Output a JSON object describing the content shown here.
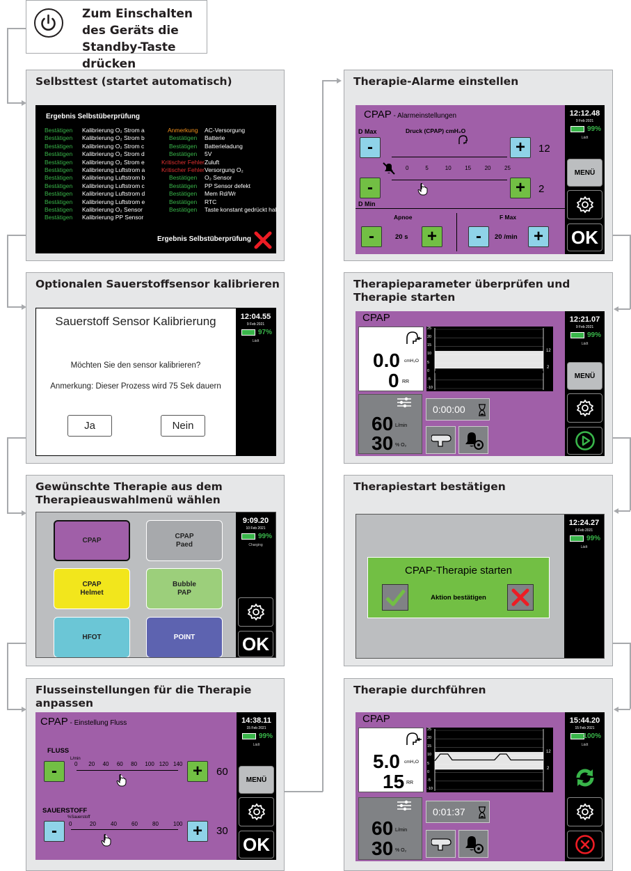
{
  "header": {
    "text1": "Zum Einschalten des Geräts die",
    "text2": "Standby-Taste drücken"
  },
  "panels": {
    "p1": {
      "title": "Selbsttest (startet automatisch)"
    },
    "p2": {
      "title": "Optionalen Sauerstoffsensor kalibrieren"
    },
    "p3": {
      "title1": "Gewünschte Therapie aus dem",
      "title2": "Therapieauswahlmenü wählen"
    },
    "p4": {
      "title1": "Flusseinstellungen für die Therapie",
      "title2": "anpassen"
    },
    "p5": {
      "title": "Therapie-Alarme einstellen"
    },
    "p6": {
      "title1": "Therapieparameter überprüfen und",
      "title2": "Therapie starten"
    },
    "p7": {
      "title": "Therapiestart bestätigen"
    },
    "p8": {
      "title": "Therapie durchführen"
    }
  },
  "selftest": {
    "heading": "Ergebnis Selbstüberprüfung",
    "left": [
      {
        "s": "Bestätigen",
        "t": "Kalibrierung O₂ Strom a"
      },
      {
        "s": "Bestätigen",
        "t": "Kalibrierung O₂ Strom b"
      },
      {
        "s": "Bestätigen",
        "t": "Kalibrierung O₂ Strom c"
      },
      {
        "s": "Bestätigen",
        "t": "Kalibrierung O₂ Strom d"
      },
      {
        "s": "Bestätigen",
        "t": "Kalibrierung O₂ Strom e"
      },
      {
        "s": "Bestätigen",
        "t": "Kalibrierung Luftstrom a"
      },
      {
        "s": "Bestätigen",
        "t": "Kalibrierung Luftstrom b"
      },
      {
        "s": "Bestätigen",
        "t": "Kalibrierung Luftstrom c"
      },
      {
        "s": "Bestätigen",
        "t": "Kalibrierung Luftstrom d"
      },
      {
        "s": "Bestätigen",
        "t": "Kalibrierung Luftstrom e"
      },
      {
        "s": "Bestätigen",
        "t": "Kalibrierung O₂ Sensor"
      },
      {
        "s": "Bestätigen",
        "t": "Kalibrierung PP Sensor"
      }
    ],
    "right": [
      {
        "s": "Anmerkung",
        "t": "AC-Versorgung",
        "c": "o"
      },
      {
        "s": "Bestätigen",
        "t": "Batterie",
        "c": "g"
      },
      {
        "s": "Bestätigen",
        "t": "Batterieladung",
        "c": "g"
      },
      {
        "s": "Bestätigen",
        "t": "5V",
        "c": "g"
      },
      {
        "s": "Kritischer Fehler",
        "t": "Zuluft",
        "c": "r"
      },
      {
        "s": "Kritischer Fehler",
        "t": "Versorgung O₂",
        "c": "r"
      },
      {
        "s": "Bestätigen",
        "t": "O₂ Sensor",
        "c": "g"
      },
      {
        "s": "Bestätigen",
        "t": "PP Sensor defekt",
        "c": "g"
      },
      {
        "s": "Bestätigen",
        "t": "Mem Rd/Wr",
        "c": "g"
      },
      {
        "s": "Bestätigen",
        "t": "RTC",
        "c": "g"
      },
      {
        "s": "Bestätigen",
        "t": "Taste konstant gedrückt halten",
        "c": "g"
      }
    ],
    "result": "Ergebnis Selbstüberprüfung"
  },
  "calib": {
    "title": "Sauerstoff Sensor Kalibrierung",
    "question": "Möchten Sie den sensor kalibrieren?",
    "note": "Anmerkung: Dieser Prozess wird 75 Sek dauern",
    "yes": "Ja",
    "no": "Nein",
    "time": "12:04.55",
    "date": "9 Feb 2021",
    "battery": "97%",
    "status": "Lädt"
  },
  "select": {
    "time": "9:09.20",
    "date": "10 Feb 2021",
    "battery": "99%",
    "status": "Charging",
    "ok": "OK",
    "b1": "CPAP",
    "b2a": "CPAP",
    "b2b": "Paed",
    "b3a": "CPAP",
    "b3b": "Helmet",
    "b4a": "Bubble",
    "b4b": "PAP",
    "b5": "HFOT",
    "b6": "POINT"
  },
  "flow": {
    "title": "CPAP",
    "subtitle": " - Einstellung Fluss",
    "time": "14:38.11",
    "date": "15 Feb 2021",
    "battery": "99%",
    "status": "Lädt",
    "menu": "MENÜ",
    "ok": "OK",
    "fluss": "FLUSS",
    "flussunit": "L/min",
    "flussticks": [
      "0",
      "20",
      "40",
      "60",
      "80",
      "100",
      "120",
      "140"
    ],
    "flussval": "60",
    "o2": "SAUERSTOFF",
    "o2unit": "%Sauerstoff",
    "o2ticks": [
      "0",
      "20",
      "40",
      "60",
      "80",
      "100"
    ],
    "o2val": "30"
  },
  "alarm": {
    "title": "CPAP",
    "subtitle": " - Alarmeinstellungen",
    "time": "12:12.48",
    "date": "9 Feb 2021",
    "battery": "99%",
    "status": "Lädt",
    "menu": "MENÜ",
    "ok": "OK",
    "dmax": "D Max",
    "dmin": "D Min",
    "druck": "Druck (CPAP) cmH₂O",
    "ticks": [
      "0",
      "5",
      "10",
      "15",
      "20",
      "25"
    ],
    "maxval": "12",
    "minval": "2",
    "apnoe": "Apnoe",
    "apnoeval": "20 s",
    "fmax": "F Max",
    "fmaxval": "20 /min"
  },
  "review": {
    "title": "CPAP",
    "time": "12:21.07",
    "date": "9 Feb 2021",
    "battery": "99%",
    "status": "Lädt",
    "menu": "MENÜ",
    "pressure": "0.0",
    "punit": "cmH₂O",
    "rr": "0",
    "rrunit": "RR",
    "timer": "0:00:00",
    "flow": "60",
    "flowunit": "L/min",
    "o2": "30",
    "o2unit": "% O₂",
    "yticks": [
      "25",
      "20",
      "15",
      "10",
      "5",
      "0",
      "-5",
      "-10"
    ],
    "hi": "12",
    "lo": "2"
  },
  "confirm": {
    "time": "12:24.27",
    "date": "9 Feb 2021",
    "battery": "99%",
    "status": "Lädt",
    "title": "CPAP-Therapie starten",
    "action": "Aktion bestätigen"
  },
  "run": {
    "title": "CPAP",
    "time": "15:44.20",
    "date": "15 Feb 2021",
    "battery": "100%",
    "status": "Lädt",
    "pressure": "5.0",
    "punit": "cmH₂O",
    "rr": "15",
    "rrunit": "RR",
    "timer": "0:01:37",
    "flow": "60",
    "flowunit": "L/min",
    "o2": "30",
    "o2unit": "% O₂",
    "yticks": [
      "25",
      "20",
      "15",
      "10",
      "5",
      "0",
      "-5",
      "-10"
    ],
    "hi": "12",
    "lo": "2"
  },
  "colors": {
    "purple": "#a05fa8",
    "panel": "#e6e7e8",
    "green": "#39b54a",
    "red": "#ed1c24"
  }
}
